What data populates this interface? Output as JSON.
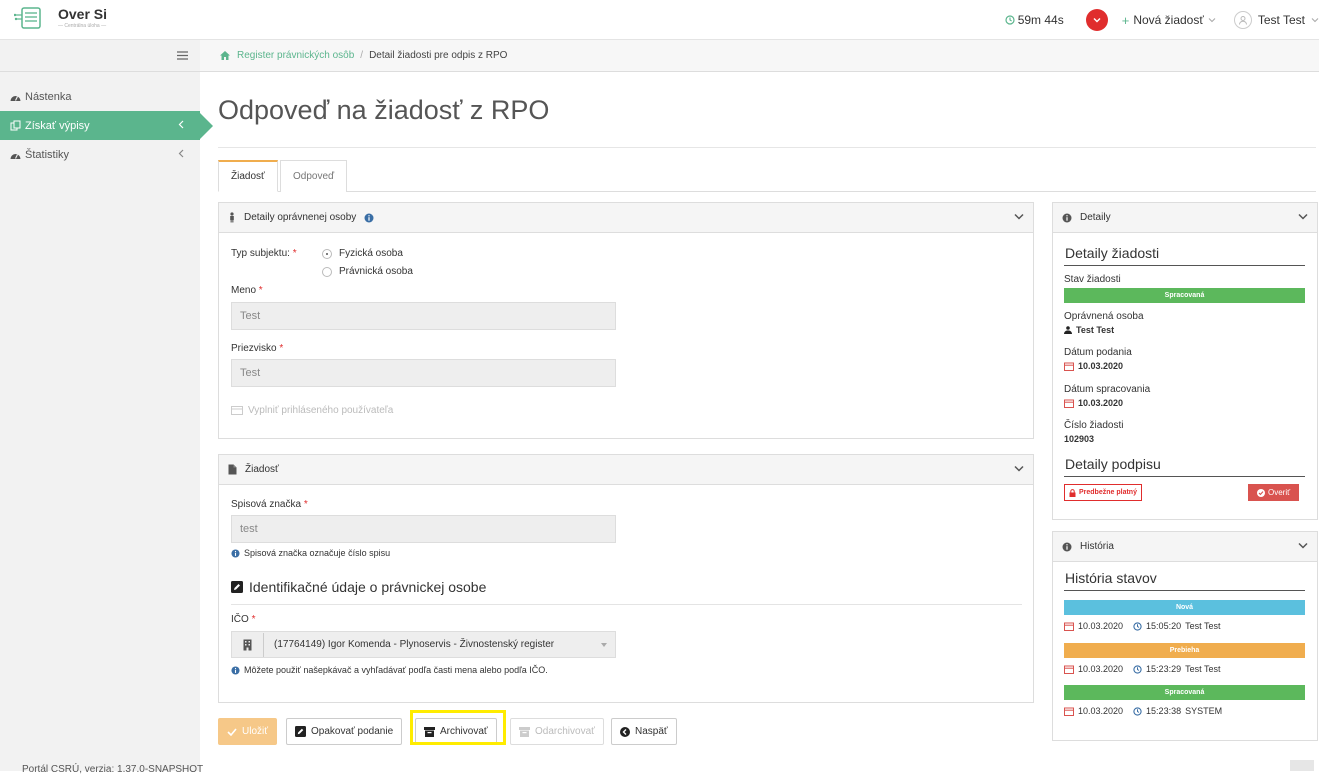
{
  "header": {
    "app_title": "Over Si",
    "app_subtitle": "— Centrálna úloha —",
    "timer": "59m 44s",
    "new_request": "Nová žiadosť",
    "user_name": "Test Test"
  },
  "sidebar": {
    "items": [
      {
        "label": "Nástenka"
      },
      {
        "label": "Získať výpisy"
      },
      {
        "label": "Štatistiky"
      }
    ],
    "version": "Portál CSRÚ, verzia: 1.37.0-SNAPSHOT"
  },
  "breadcrumb": {
    "link": "Register právnických osôb",
    "separator": "/",
    "current": "Detail žiadosti pre odpis z RPO"
  },
  "page": {
    "title": "Odpoveď na žiadosť z RPO",
    "tabs": [
      {
        "label": "Žiadosť"
      },
      {
        "label": "Odpoveď"
      }
    ]
  },
  "person_panel": {
    "title": "Detaily oprávnenej osoby",
    "subject_type_label": "Typ subjektu:",
    "req_mark": "*",
    "radio_physical": "Fyzická osoba",
    "radio_legal": "Právnická osoba",
    "name_label": "Meno",
    "name_value": "Test",
    "surname_label": "Priezvisko",
    "surname_value": "Test",
    "fill_user": "Vyplniť prihláseného používateľa"
  },
  "request_panel": {
    "title": "Žiadosť",
    "file_label": "Spisová značka",
    "file_value": "test",
    "file_hint": "Spisová značka označuje číslo spisu",
    "section_title": "Identifikačné údaje o právnickej osobe",
    "ico_label": "IČO",
    "ico_value": "(17764149) Igor Komenda - Plynoservis - Živnostenský register",
    "ico_hint": "Môžete použiť našepkávač a vyhľadávať podľa časti mena alebo podľa IČO."
  },
  "buttons": {
    "save": "Uložiť",
    "resubmit": "Opakovať podanie",
    "archive": "Archivovať",
    "unarchive": "Odarchivovať",
    "back": "Naspäť"
  },
  "details_panel": {
    "header": "Detaily",
    "title": "Detaily žiadosti",
    "status_label": "Stav žiadosti",
    "status_value": "Spracovaná",
    "person_label": "Oprávnená osoba",
    "person_value": "Test Test",
    "submitted_label": "Dátum podania",
    "submitted_value": "10.03.2020",
    "processed_label": "Dátum spracovania",
    "processed_value": "10.03.2020",
    "number_label": "Číslo žiadosti",
    "number_value": "102903",
    "signature_title": "Detaily podpisu",
    "signature_badge": "Predbežne platný",
    "verify_button": "Overiť"
  },
  "history_panel": {
    "header": "História",
    "title": "História stavov",
    "entries": [
      {
        "status": "Nová",
        "date": "10.03.2020",
        "time": "15:05:20",
        "user": "Test Test"
      },
      {
        "status": "Prebieha",
        "date": "10.03.2020",
        "time": "15:23:29",
        "user": "Test Test"
      },
      {
        "status": "Spracovaná",
        "date": "10.03.2020",
        "time": "15:23:38",
        "user": "SYSTEM"
      }
    ]
  },
  "colors": {
    "accent_green": "#5bb58d",
    "status_green": "#5cb85c",
    "status_blue": "#5bc0de",
    "status_orange": "#f0ad4e",
    "danger_red": "#d9534f",
    "highlight_yellow": "#ffec00"
  }
}
